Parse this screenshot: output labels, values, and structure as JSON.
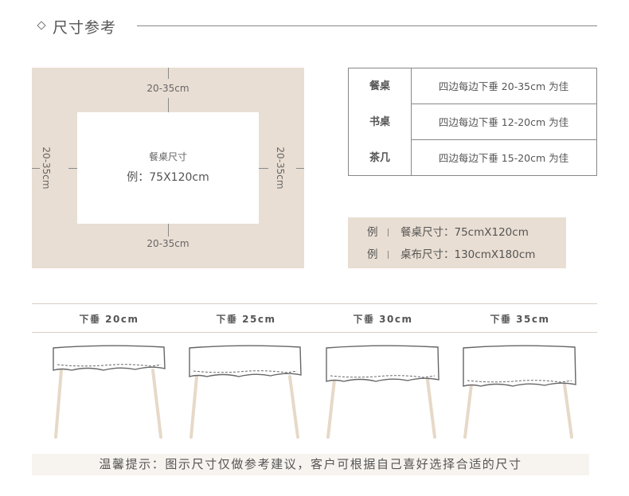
{
  "header": {
    "title": "尺寸参考"
  },
  "diagram": {
    "top_label": "20-35cm",
    "bottom_label": "20-35cm",
    "left_label": "20-35cm",
    "right_label": "20-35cm",
    "inner_title": "餐桌尺寸",
    "inner_example": "例：75X120cm"
  },
  "spec_table": {
    "rows": [
      {
        "name": "餐桌",
        "desc": "四边每边下垂 20-35cm 为佳"
      },
      {
        "name": "书桌",
        "desc": "四边每边下垂 12-20cm 为佳"
      },
      {
        "name": "茶几",
        "desc": "四边每边下垂 15-20cm 为佳"
      }
    ]
  },
  "example": {
    "rows": [
      {
        "lead": "例",
        "text": "餐桌尺寸：75cmX120cm"
      },
      {
        "lead": "例",
        "text": "桌布尺寸：130cmX180cm"
      }
    ]
  },
  "drops": {
    "labels": [
      "下垂 20cm",
      "下垂 25cm",
      "下垂 30cm",
      "下垂 35cm"
    ]
  },
  "note": {
    "text": "温馨提示：图示尺寸仅做参考建议，客户可根据自己喜好选择合适的尺寸"
  },
  "colors": {
    "beige": "#e9ded3",
    "leg": "#e6d9c8",
    "line": "#888888",
    "text": "#555555"
  }
}
